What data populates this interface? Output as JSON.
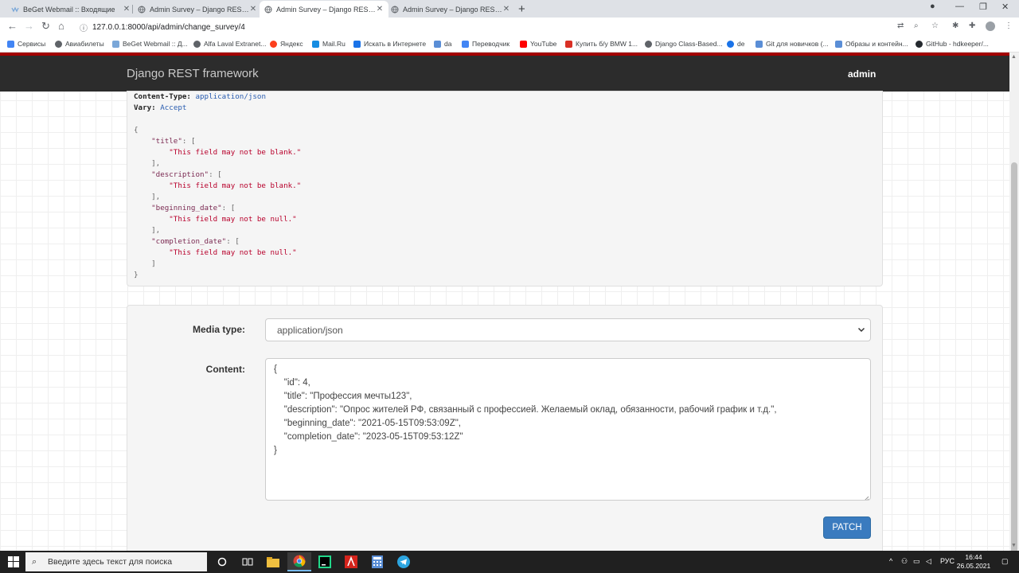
{
  "browser": {
    "tabs": [
      {
        "title": "BeGet Webmail :: Входящие",
        "favicon": "beget-icon"
      },
      {
        "title": "Admin Survey – Django REST fra",
        "favicon": "globe-icon"
      },
      {
        "title": "Admin Survey – Django REST fra",
        "favicon": "globe-icon"
      },
      {
        "title": "Admin Survey – Django REST fra",
        "favicon": "globe-icon"
      }
    ],
    "new_tab": "+",
    "address": "127.0.0.1:8000/api/admin/change_survey/4",
    "bookmarks": [
      {
        "label": "Сервисы",
        "icon": "apps-grid-icon",
        "color": "#4285f4"
      },
      {
        "label": "Авиабилеты",
        "icon": "globe-icon",
        "color": "#5f6368"
      },
      {
        "label": "BeGet Webmail :: Д...",
        "icon": "beget-icon",
        "color": "#7aa7d8"
      },
      {
        "label": "Alfa Laval Extranet...",
        "icon": "globe-icon",
        "color": "#5f6368"
      },
      {
        "label": "Яндекс",
        "icon": "yandex-icon",
        "color": "#fc3f1d"
      },
      {
        "label": "Mail.Ru",
        "icon": "mailru-icon",
        "color": "#168de2"
      },
      {
        "label": "Искать в Интернете",
        "icon": "search-icon",
        "color": "#1a73e8"
      },
      {
        "label": "da",
        "icon": "page-icon",
        "color": "#5a8ed6"
      },
      {
        "label": "Переводчик",
        "icon": "translate-icon",
        "color": "#4285f4"
      },
      {
        "label": "YouTube",
        "icon": "youtube-icon",
        "color": "#ff0000"
      },
      {
        "label": "Купить б/у BMW 1...",
        "icon": "drom-icon",
        "color": "#d93025"
      },
      {
        "label": "Django Class-Based...",
        "icon": "globe-icon",
        "color": "#5f6368"
      },
      {
        "label": "de",
        "icon": "de-icon",
        "color": "#1a73e8"
      },
      {
        "label": "Git для новичков (...",
        "icon": "page-icon",
        "color": "#5a8ed6"
      },
      {
        "label": "Образы и контейн...",
        "icon": "page-icon",
        "color": "#5a8ed6"
      },
      {
        "label": "GitHub - hdkeeper/...",
        "icon": "github-icon",
        "color": "#24292e"
      }
    ]
  },
  "drf": {
    "brand": "Django REST framework",
    "user": "admin",
    "response": {
      "headers": [
        {
          "key": "Content-Type:",
          "value": "application/json"
        },
        {
          "key": "Vary:",
          "value": "Accept"
        }
      ],
      "errors": [
        {
          "field": "\"title\"",
          "message": "\"This field may not be blank.\""
        },
        {
          "field": "\"description\"",
          "message": "\"This field may not be blank.\""
        },
        {
          "field": "\"beginning_date\"",
          "message": "\"This field may not be null.\""
        },
        {
          "field": "\"completion_date\"",
          "message": "\"This field may not be null.\""
        }
      ]
    },
    "form": {
      "media_type_label": "Media type:",
      "media_type_value": "application/json",
      "content_label": "Content:",
      "content_lines": [
        "{",
        "    \"id\": 4,",
        "    \"title\": \"Профессия мечты123\",",
        "    \"description\": \"Опрос жителей РФ, связанный с профессией. Желаемый оклад, обязанности, рабочий график и т.д.\",",
        "    \"beginning_date\": \"2021-05-15T09:53:09Z\",",
        "    \"completion_date\": \"2023-05-15T09:53:12Z\"",
        "}"
      ],
      "submit_label": "PATCH"
    }
  },
  "taskbar": {
    "search_placeholder": "Введите здесь текст для поиска",
    "language": "РУС",
    "time": "16:44",
    "date": "26.05.2021"
  },
  "colors": {
    "drf_navbar": "#2c2c2c",
    "drf_accent_line": "#a30000",
    "patch_button": "#3a7bbf",
    "error_string": "#b8002b"
  }
}
